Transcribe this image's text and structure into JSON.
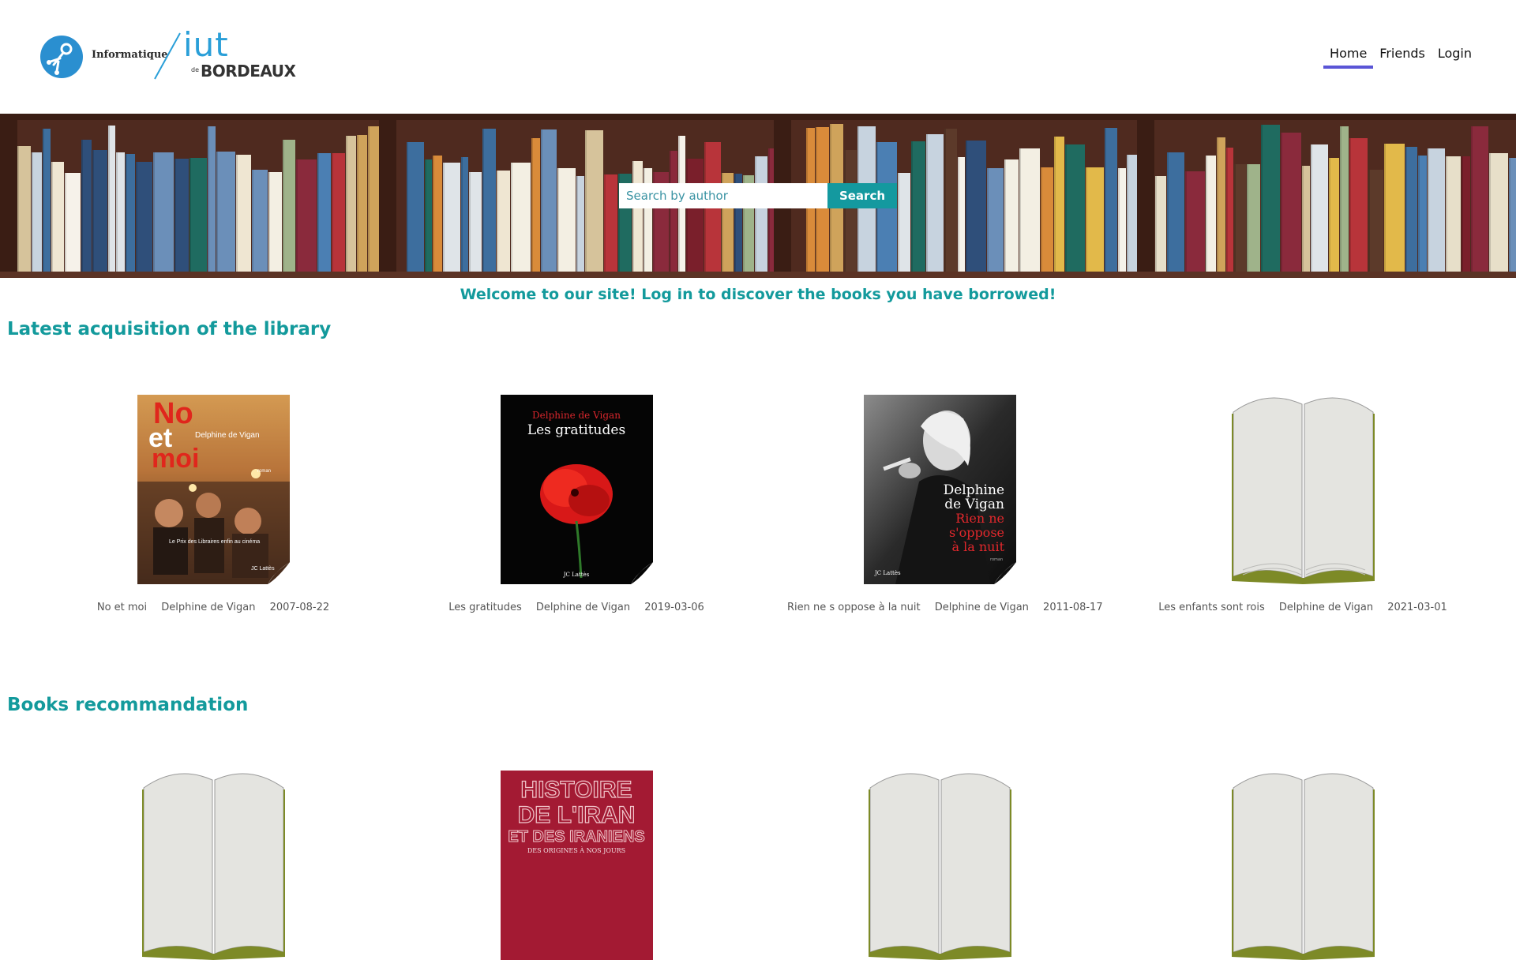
{
  "brand": {
    "logo_text": "Informatique",
    "logo_iut": "iut",
    "logo_de": "de",
    "logo_city": "BORDEAUX",
    "accent_color": "#139a9c"
  },
  "nav": {
    "items": [
      {
        "label": "Home",
        "active": true
      },
      {
        "label": "Friends",
        "active": false
      },
      {
        "label": "Login",
        "active": false
      }
    ]
  },
  "search": {
    "placeholder": "Search by author",
    "value": "",
    "button_label": "Search"
  },
  "welcome": "Welcome to our site! Log in to discover the books you have borrowed!",
  "latest": {
    "title": "Latest acquisition of the library",
    "books": [
      {
        "title": "No et moi",
        "author": "Delphine de Vigan",
        "date": "2007-08-22",
        "cover": {
          "type": "photo",
          "big_line1": "No",
          "big_line2": "et",
          "big_line3": "moi",
          "author": "Delphine de Vigan",
          "genre": "roman",
          "caption": "Le Prix des Libraires enfin au cinéma",
          "publisher": "JC Lattès"
        }
      },
      {
        "title": "Les gratitudes",
        "author": "Delphine de Vigan",
        "date": "2019-03-06",
        "cover": {
          "type": "poppy",
          "author": "Delphine de Vigan",
          "title": "Les gratitudes",
          "publisher": "JC Lattès"
        }
      },
      {
        "title": "Rien ne s oppose à la nuit",
        "author": "Delphine de Vigan",
        "date": "2011-08-17",
        "cover": {
          "type": "portrait",
          "author_line1": "Delphine",
          "author_line2": "de Vigan",
          "title_line1": "Rien ne",
          "title_line2": "s'oppose",
          "title_line3": "à la nuit",
          "publisher": "JC Lattès",
          "genre": "roman"
        }
      },
      {
        "title": "Les enfants sont rois",
        "author": "Delphine de Vigan",
        "date": "2021-03-01",
        "cover": {
          "type": "placeholder"
        }
      }
    ]
  },
  "recommend": {
    "title": "Books recommandation",
    "books": [
      {
        "cover": {
          "type": "placeholder"
        }
      },
      {
        "cover": {
          "type": "iran",
          "line1": "HISTOIRE",
          "line2": "DE L'IRAN",
          "line3": "ET DES IRANIENS",
          "line4": "DES ORIGINES À NOS JOURS"
        }
      },
      {
        "cover": {
          "type": "placeholder"
        }
      },
      {
        "cover": {
          "type": "placeholder"
        }
      }
    ]
  }
}
